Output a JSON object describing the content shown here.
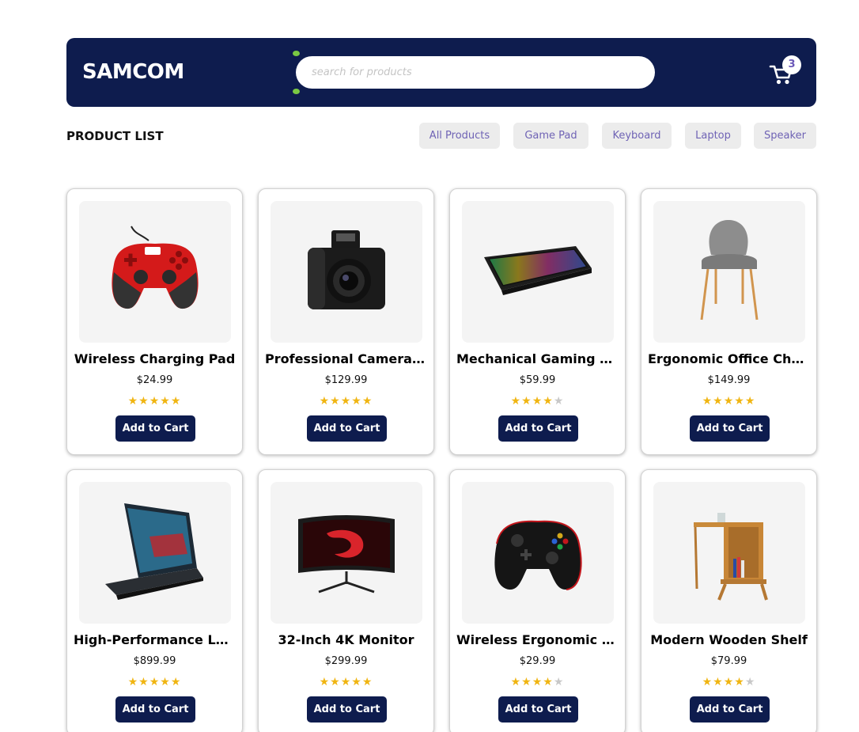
{
  "header": {
    "logo": "SAMCOM",
    "search_placeholder": "search for products",
    "cart_count": "3",
    "bg_color": "#0e1c4e"
  },
  "list_title": "PRODUCT LIST",
  "filters": [
    "All Products",
    "Game Pad",
    "Keyboard",
    "Laptop",
    "Speaker"
  ],
  "add_label": "Add to Cart",
  "products": [
    {
      "name": "Wireless Charging Pad",
      "price": "$24.99",
      "rating": 5,
      "icon": "gamepad-red"
    },
    {
      "name": "Professional Camera ...",
      "price": "$129.99",
      "rating": 5,
      "icon": "camera"
    },
    {
      "name": "Mechanical Gaming K...",
      "price": "$59.99",
      "rating": 4,
      "icon": "keyboard"
    },
    {
      "name": "Ergonomic Office Chair",
      "price": "$149.99",
      "rating": 5,
      "icon": "chair"
    },
    {
      "name": "High-Performance La...",
      "price": "$899.99",
      "rating": 5,
      "icon": "laptop"
    },
    {
      "name": "32-Inch 4K Monitor",
      "price": "$299.99",
      "rating": 5,
      "icon": "monitor"
    },
    {
      "name": "Wireless Ergonomic P...",
      "price": "$29.99",
      "rating": 4,
      "icon": "gamepad-black"
    },
    {
      "name": "Modern Wooden Shelf",
      "price": "$79.99",
      "rating": 4,
      "icon": "shelf"
    }
  ]
}
